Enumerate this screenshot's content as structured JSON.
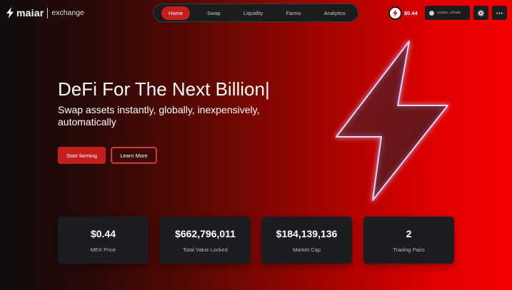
{
  "brand": {
    "name": "maiar",
    "sub": "exchange"
  },
  "nav": {
    "items": [
      {
        "label": "Home",
        "active": true
      },
      {
        "label": "Swap",
        "active": false
      },
      {
        "label": "Liquidity",
        "active": false
      },
      {
        "label": "Farms",
        "active": false
      },
      {
        "label": "Analytics",
        "active": false
      }
    ]
  },
  "header": {
    "price": "$0.44",
    "wallet": "erd1he...d7zdkj"
  },
  "hero": {
    "title": "DeFi For The Next Billion|",
    "subtitle": "Swap assets instantly, globally, inexpensively, automatically",
    "primary_button": "Start farming",
    "secondary_button": "Learn More"
  },
  "stats": [
    {
      "value": "$0.44",
      "label": "MEX Price"
    },
    {
      "value": "$662,796,011",
      "label": "Total Value Locked"
    },
    {
      "value": "$184,139,136",
      "label": "Market Cap"
    },
    {
      "value": "2",
      "label": "Trading Pairs"
    }
  ],
  "colors": {
    "accent": "#c41e1e",
    "card": "#1b1d21",
    "nav_bg": "#1b1c1e"
  },
  "icons": {
    "logo": "lightning-bolt-icon",
    "coin": "mex-token-icon",
    "wallet": "user-icon",
    "settings": "gear-icon",
    "more": "ellipsis-icon"
  }
}
